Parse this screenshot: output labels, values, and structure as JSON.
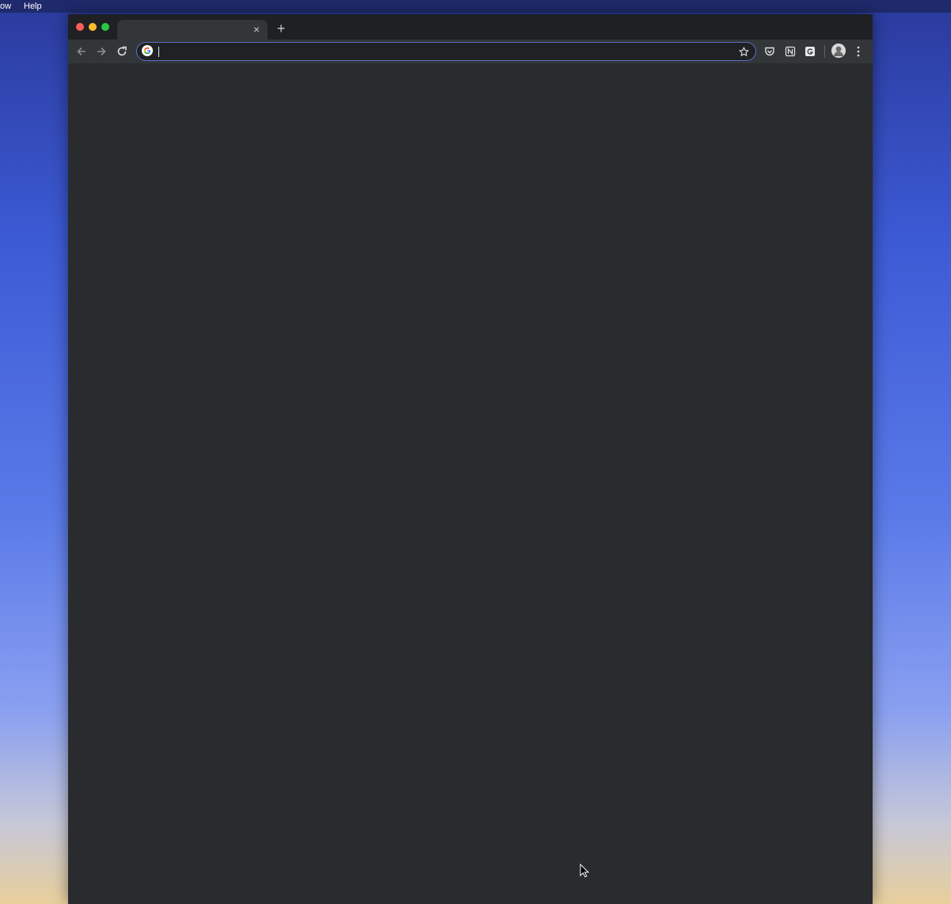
{
  "menubar": {
    "window_label": "ow",
    "help_label": "Help"
  },
  "browser": {
    "tab": {
      "title": "",
      "close_glyph": "×"
    },
    "new_tab_glyph": "+",
    "omnibox": {
      "value": "",
      "placeholder": ""
    },
    "icons": {
      "back": "arrow-left-icon",
      "forward": "arrow-right-icon",
      "reload": "reload-icon",
      "google": "google-icon",
      "bookmark": "star-icon",
      "pocket": "pocket-icon",
      "notion": "notion-icon",
      "grammarly": "g-extension-icon",
      "profile": "avatar-icon",
      "menu": "kebab-menu-icon"
    }
  },
  "colors": {
    "traffic_close": "#fe5f57",
    "traffic_minimize": "#febc2e",
    "traffic_maximize": "#28c840",
    "omnibox_focus": "#5a6fbf",
    "content_bg": "#292b2e"
  }
}
